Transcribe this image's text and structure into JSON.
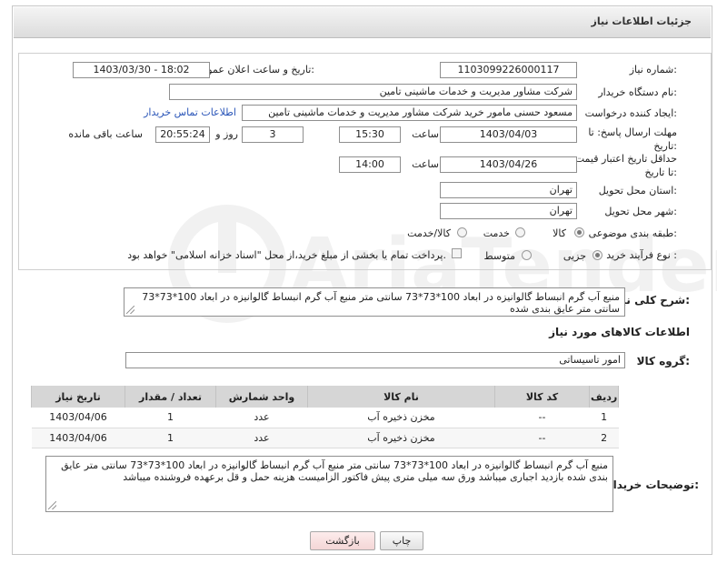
{
  "page_title": "جزئیات اطلاعات نیاز",
  "form": {
    "need_number_label": "شماره نیاز:",
    "need_number": "1103099226000117",
    "announce_label": "تاریخ و ساعت اعلان عمومی:",
    "announce_value": "1403/03/30 - 18:02",
    "buyer_org_label": "نام دستگاه خریدار:",
    "buyer_org": "شرکت مشاور مدیریت و خدمات ماشینی تامین",
    "requester_label": "ایجاد کننده درخواست:",
    "requester": "مسعود حسنی مامور خرید شرکت مشاور مدیریت و خدمات ماشینی تامین",
    "contact_link": "اطلاعات تماس خریدار",
    "deadline_label": "مهلت ارسال پاسخ: تا تاریخ:",
    "deadline_date": "1403/04/03",
    "time_label": "ساعت",
    "deadline_time": "15:30",
    "days_value": "3",
    "days_label": "روز و",
    "remaining_time": "20:55:24",
    "remaining_label": "ساعت باقی مانده",
    "validity_label": "حداقل تاریخ اعتبار قیمت: تا تاریخ:",
    "validity_date": "1403/04/26",
    "validity_time": "14:00",
    "province_label": "استان محل تحویل:",
    "province": "تهران",
    "city_label": "شهر محل تحویل:",
    "city": "تهران",
    "category_label": "طبقه بندی موضوعی:",
    "category_options": [
      "کالا",
      "خدمت",
      "کالا/خدمت"
    ],
    "category_selected": "کالا",
    "process_label": "نوع فرآیند خرید :",
    "process_options": [
      "جزیی",
      "متوسط"
    ],
    "process_selected": "جزیی",
    "payment_note": "پرداخت تمام یا بخشی از مبلغ خرید،از محل \"اسناد خزانه اسلامی\" خواهد بود."
  },
  "description": {
    "label": "شرح کلی نیاز:",
    "text": "منبع آب گرم انبساط   گالوانیزه در ابعاد 100*73*73 سانتی متر    منبع آب گرم انبساط   گالوانیزه در ابعاد 100*73*73 سانتی متر عایق بندی شده"
  },
  "goods": {
    "section_title": "اطلاعات کالاهای مورد نیاز",
    "group_label": "گروه کالا:",
    "group_value": "امور تاسیساتی",
    "columns": [
      "ردیف",
      "کد کالا",
      "نام کالا",
      "واحد شمارش",
      "تعداد / مقدار",
      "تاریخ نیاز"
    ],
    "rows": [
      {
        "idx": "1",
        "code": "--",
        "name": "مخزن ذخیره آب",
        "unit": "عدد",
        "qty": "1",
        "date": "1403/04/06"
      },
      {
        "idx": "2",
        "code": "--",
        "name": "مخزن ذخیره آب",
        "unit": "عدد",
        "qty": "1",
        "date": "1403/04/06"
      }
    ]
  },
  "buyer_notes": {
    "label": "توضیحات خریدار:",
    "text": "منبع آب گرم انبساط   گالوانیزه در ابعاد 100*73*73 سانتی متر    منبع آب گرم انبساط   گالوانیزه در ابعاد 100*73*73 سانتی متر عایق بندی شده    بازدید اجباری میباشد  ورق سه میلی متری  پیش فاکتور الزامیست هزینه حمل و قل برعهده فروشنده میباشد"
  },
  "buttons": {
    "print": "چاپ",
    "back": "بازگشت"
  },
  "watermark_text": "AriaTender.net"
}
